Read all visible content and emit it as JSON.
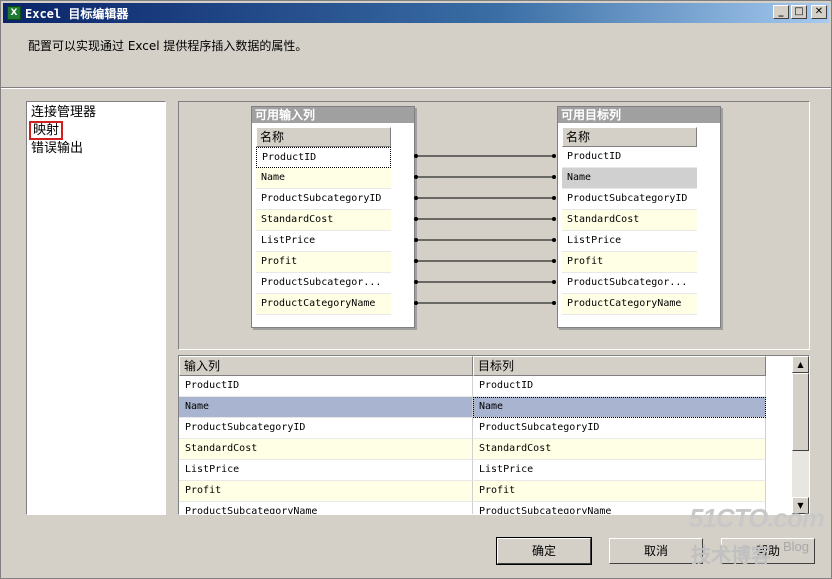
{
  "window": {
    "title": "Excel 目标编辑器",
    "icon": "excel-icon",
    "controls": [
      "minimize",
      "maximize",
      "close"
    ]
  },
  "description": "配置可以实现通过 Excel 提供程序插入数据的属性。",
  "nav": {
    "items": [
      {
        "label": "连接管理器"
      },
      {
        "label": "映射"
      },
      {
        "label": "错误输出"
      }
    ],
    "selected": "映射"
  },
  "input_box": {
    "title": "可用输入列",
    "header": "名称",
    "rows": [
      "ProductID",
      "Name",
      "ProductSubcategoryID",
      "StandardCost",
      "ListPrice",
      "Profit",
      "ProductSubcategor...",
      "ProductCategoryName"
    ]
  },
  "target_box": {
    "title": "可用目标列",
    "header": "名称",
    "rows": [
      "ProductID",
      "Name",
      "ProductSubcategoryID",
      "StandardCost",
      "ListPrice",
      "Profit",
      "ProductSubcategor...",
      "ProductCategoryName"
    ]
  },
  "grid": {
    "headers": [
      "输入列",
      "目标列"
    ],
    "rows": [
      [
        "ProductID",
        "ProductID"
      ],
      [
        "Name",
        "Name"
      ],
      [
        "ProductSubcategoryID",
        "ProductSubcategoryID"
      ],
      [
        "StandardCost",
        "StandardCost"
      ],
      [
        "ListPrice",
        "ListPrice"
      ],
      [
        "Profit",
        "Profit"
      ],
      [
        "ProductSubcategoryName",
        "ProductSubcategoryName"
      ]
    ]
  },
  "buttons": {
    "ok": "确定",
    "cancel": "取消",
    "help": "帮助"
  },
  "watermark": {
    "line1": "51CTO.com",
    "line2": "技术博客",
    "line3": "Blog"
  }
}
